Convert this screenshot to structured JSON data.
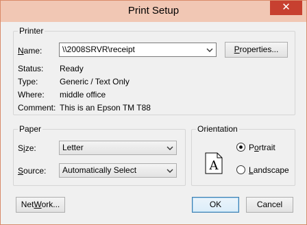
{
  "window": {
    "title": "Print Setup",
    "close_glyph": "✕"
  },
  "printer": {
    "group_label": "Printer",
    "name_label_u": "N",
    "name_label_rest": "ame:",
    "name_value": "\\\\2008SRVR\\receipt",
    "properties_u": "P",
    "properties_rest": "roperties...",
    "status_label": "Status:",
    "status_value": "Ready",
    "type_label": "Type:",
    "type_value": "Generic / Text Only",
    "where_label": "Where:",
    "where_value": "middle office",
    "comment_label": "Comment:",
    "comment_value": "This is an Epson TM T88"
  },
  "paper": {
    "group_label": "Paper",
    "size_label_u": "i",
    "size_label_pre": "S",
    "size_label_post": "ze:",
    "size_value": "Letter",
    "source_label_u": "S",
    "source_label_rest": "ource:",
    "source_value": "Automatically Select"
  },
  "orientation": {
    "group_label": "Orientation",
    "portrait_u": "o",
    "portrait_pre": "P",
    "portrait_post": "rtrait",
    "landscape_u": "L",
    "landscape_rest": "andscape",
    "preview_letter": "A",
    "selected": "portrait"
  },
  "buttons": {
    "network_u": "W",
    "network_pre": "Net",
    "network_post": "ork...",
    "ok": "OK",
    "cancel": "Cancel"
  },
  "colors": {
    "titlebar": "#f1c7b4",
    "close": "#c74030",
    "default_border": "#3c7fb1"
  },
  "icons": {
    "close": "close-icon",
    "dropdown": "chevron-down-icon",
    "preview": "page-portrait-icon"
  }
}
